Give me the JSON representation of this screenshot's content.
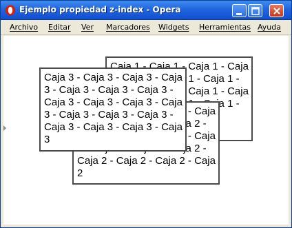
{
  "window": {
    "title": "Ejemplo propiedad z-index - Opera",
    "accent": "#2166e0",
    "close_color": "#c4381e"
  },
  "menu": {
    "items": [
      "Archivo",
      "Editar",
      "Ver",
      "Marcadores",
      "Widgets",
      "Herramientas",
      "Ayuda"
    ]
  },
  "boxes": {
    "caja1": "Caja 1 - Caja 1 - Caja 1 - Caja 1 - Caja 1 - Caja 1 - Caja 1 - Caja 1 - Caja 1 - Caja 1 - Caja 1 - Caja 1 - Caja 1 - Caja 1 - Caja 1 - Caja 1 - Caja 1",
    "caja2": "Caja 2 - Caja 2 - Caja 2 - Caja 2 - Caja 2 - Caja 2 - Caja 2 - Caja 2 - Caja 2 - Caja 2 - Caja 2 - Caja 2 - Caja 2 - Caja 2 - Caja 2 - Caja 2 - Caja 2 - Caja 2",
    "caja3": "Caja 3 - Caja 3 - Caja 3 - Caja 3 - Caja 3 - Caja 3 - Caja 3 - Caja 3 - Caja 3 - Caja 3 - Caja 3 - Caja 3 - Caja 3 - Caja 3 - Caja 3 - Caja 3 - Caja 3 - Caja 3"
  },
  "icons": {
    "app": "opera-icon",
    "minimize": "minimize-icon",
    "maximize": "maximize-icon",
    "close": "close-icon"
  }
}
